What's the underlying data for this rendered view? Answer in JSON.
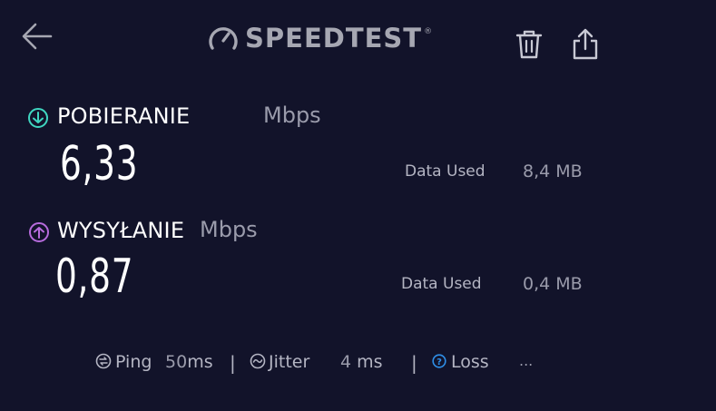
{
  "header": {
    "logo_text": "SPEEDTEST",
    "logo_mark": "®"
  },
  "download": {
    "label": "POBIERANIE",
    "unit": "Mbps",
    "value": "6,33",
    "data_used_label": "Data Used",
    "data_used_value": "8,4 MB",
    "icon_color": "#3fd6c0"
  },
  "upload": {
    "label": "WYSYŁANIE",
    "unit": "Mbps",
    "value": "0,87",
    "data_used_label": "Data Used",
    "data_used_value": "0,4 MB",
    "icon_color": "#b66bdc"
  },
  "stats": {
    "ping_label": "Ping",
    "ping_value": "50",
    "ping_unit": "ms",
    "jitter_label": "Jitter",
    "jitter_value": "4",
    "jitter_unit": "ms",
    "loss_label": "Loss",
    "loss_value": "...",
    "separator": "|",
    "loss_icon_color": "#2f8fe8"
  },
  "icons": {
    "back": "arrow-left-icon",
    "trash": "trash-icon",
    "share": "share-icon",
    "download": "download-arrow-icon",
    "upload": "upload-arrow-icon",
    "ping": "ping-icon",
    "jitter": "jitter-icon",
    "loss": "loss-help-icon"
  }
}
